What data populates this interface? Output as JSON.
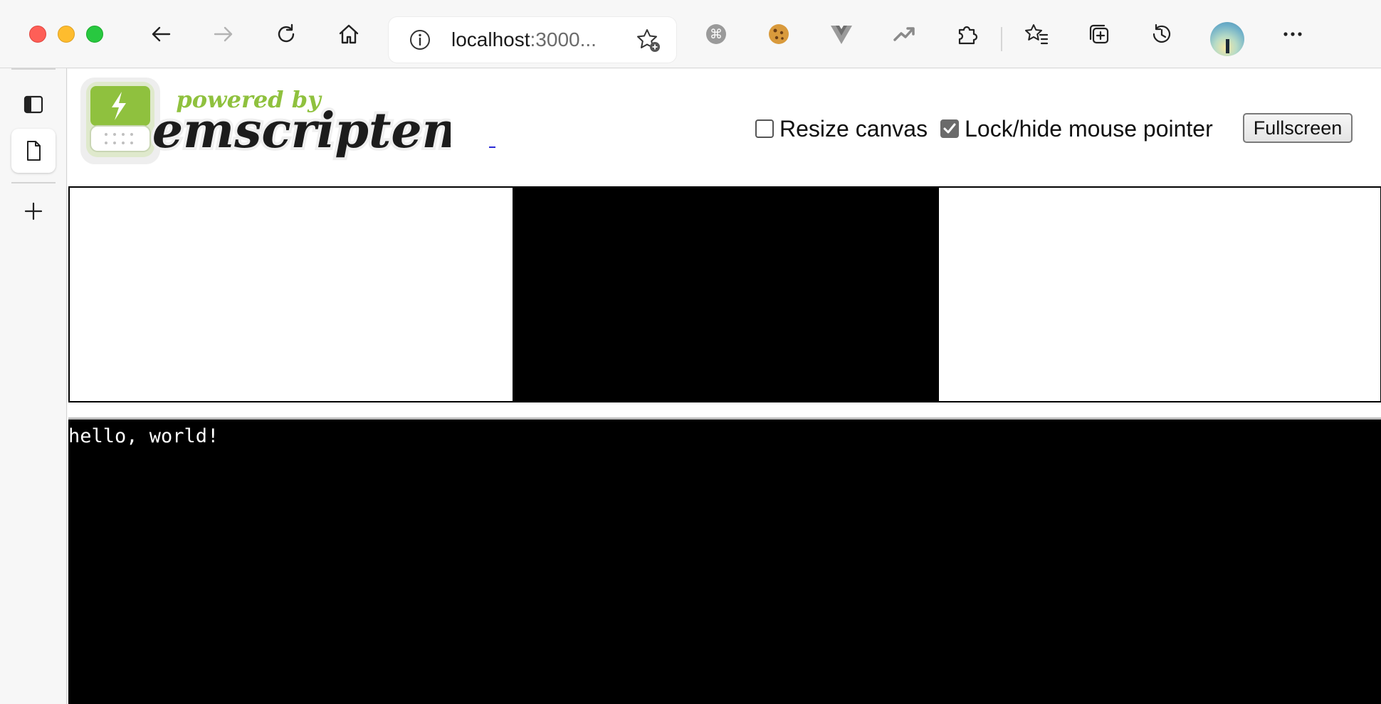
{
  "browser": {
    "url_host": "localhost",
    "url_rest": ":3000...",
    "toolbar_icons": [
      "back-icon",
      "forward-icon",
      "reload-icon",
      "home-icon",
      "extension-command-icon",
      "cookie-icon",
      "vue-devtools-icon",
      "trend-icon",
      "extensions-puzzle-icon",
      "favorites-icon",
      "collections-icon",
      "history-icon",
      "profile-avatar",
      "more-menu-icon"
    ],
    "sidebar_icons": [
      "tab-layout-icon",
      "page-icon",
      "new-tab-plus-icon"
    ]
  },
  "logo": {
    "tagline": "powered by",
    "name": "emscripten",
    "tagline_color": "#8fc13e",
    "name_color": "#1c1c1c"
  },
  "controls": {
    "resize_canvas_label": "Resize canvas",
    "resize_canvas_checked": false,
    "lock_pointer_label": "Lock/hide mouse pointer",
    "lock_pointer_checked": true,
    "fullscreen_label": "Fullscreen"
  },
  "console": {
    "output": "hello, world!"
  }
}
